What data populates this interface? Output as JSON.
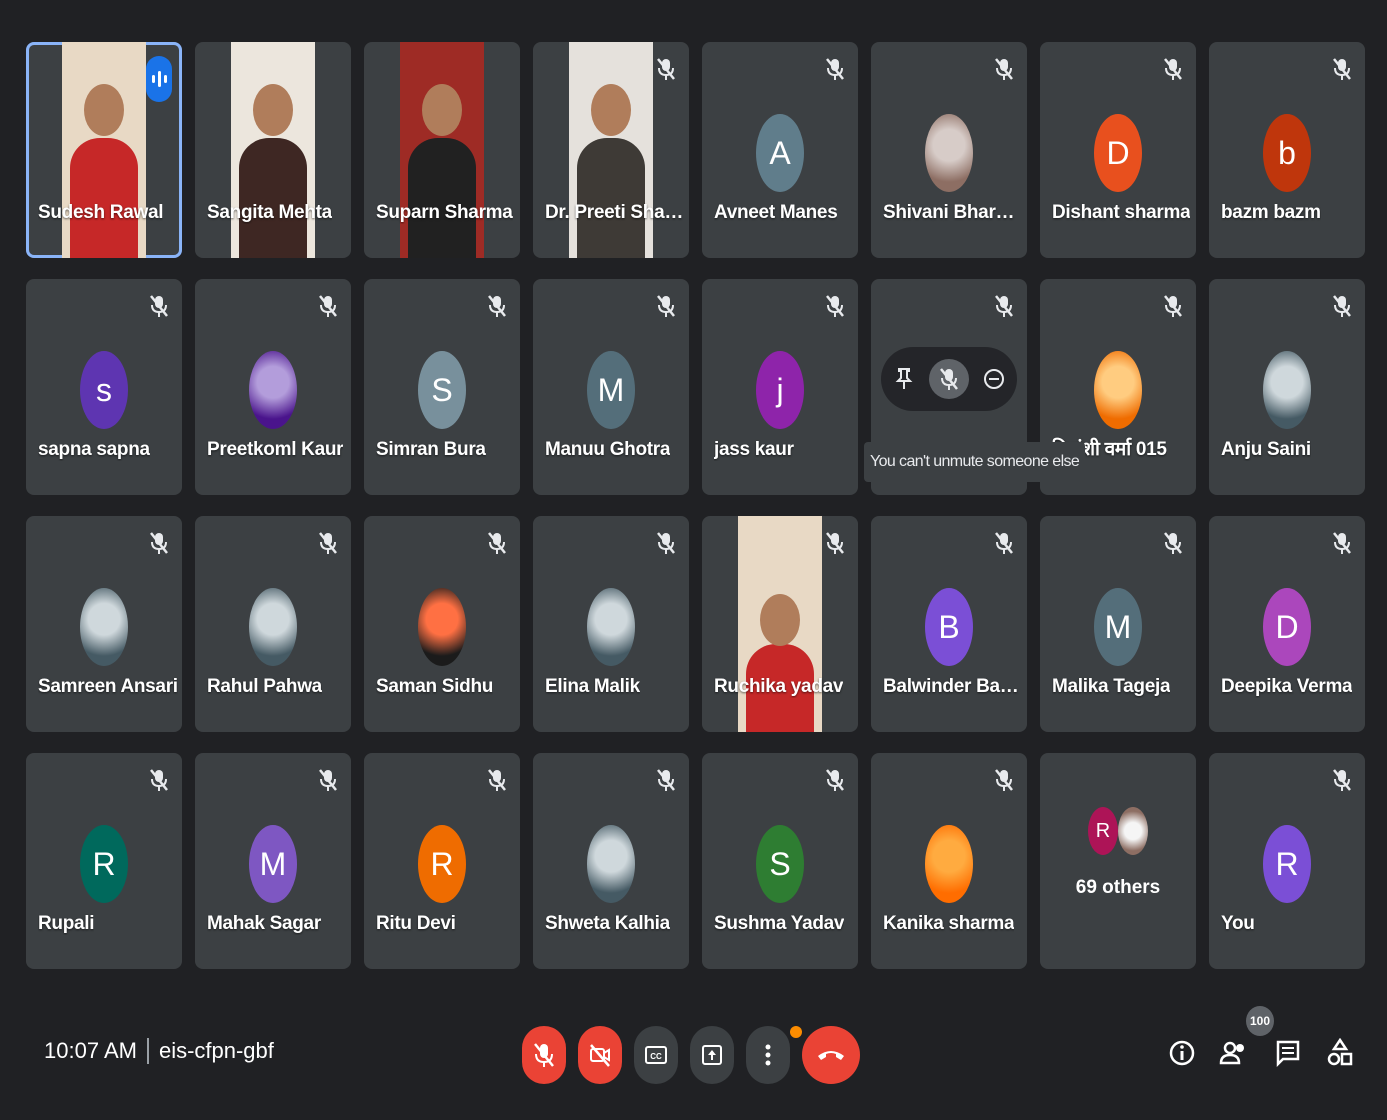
{
  "meeting": {
    "time": "10:07 AM",
    "code": "eis-cfpn-gbf",
    "participant_count": "100",
    "tooltip": "You can't unmute someone else"
  },
  "colors": {
    "background": "#202124",
    "tile": "#3c4043",
    "speaking_border": "#8ab4f8",
    "end_call": "#ea4335"
  },
  "participants": [
    {
      "name": "Sudesh Rawal",
      "kind": "video",
      "speaking": true
    },
    {
      "name": "Sangita Mehta",
      "kind": "video"
    },
    {
      "name": "Suparn Sharma",
      "kind": "video"
    },
    {
      "name": "Dr. Preeti Shar...",
      "kind": "video",
      "muted": true
    },
    {
      "name": "Avneet Manes",
      "initial": "A",
      "color": "#607d8b",
      "muted": true
    },
    {
      "name": "Shivani Bhargav",
      "kind": "photo",
      "icon": "cartoon-mouse",
      "muted": true
    },
    {
      "name": "Dishant sharma",
      "initial": "D",
      "color": "#e8501e",
      "muted": true
    },
    {
      "name": "bazm bazm",
      "initial": "b",
      "color": "#bf360c",
      "muted": true
    },
    {
      "name": "sapna sapna",
      "initial": "s",
      "color": "#5e35b1",
      "muted": true
    },
    {
      "name": "Preetkoml Kaur",
      "kind": "photo",
      "icon": "moon-art",
      "muted": true
    },
    {
      "name": "Simran Bura",
      "initial": "S",
      "color": "#78909c",
      "muted": true
    },
    {
      "name": "Manuu Ghotra",
      "initial": "M",
      "color": "#546e7a",
      "muted": true
    },
    {
      "name": "jass kaur",
      "initial": "j",
      "color": "#8e24aa",
      "muted": true
    },
    {
      "name": "",
      "kind": "hover",
      "muted": true
    },
    {
      "name": "दिपांशी वर्मा 015",
      "kind": "photo",
      "icon": "hand-photo",
      "muted": true
    },
    {
      "name": "Anju Saini",
      "kind": "photo",
      "icon": "person-photo",
      "muted": true
    },
    {
      "name": "Samreen Ansari",
      "kind": "photo",
      "icon": "person-photo",
      "muted": true
    },
    {
      "name": "Rahul Pahwa",
      "kind": "photo",
      "icon": "person-photo",
      "muted": true
    },
    {
      "name": "Saman Sidhu",
      "kind": "photo",
      "icon": "fire-logo",
      "muted": true
    },
    {
      "name": "Elina Malik",
      "kind": "photo",
      "icon": "person-photo",
      "muted": true
    },
    {
      "name": "Ruchika yadav",
      "kind": "video",
      "muted": true
    },
    {
      "name": "Balwinder Barna",
      "initial": "B",
      "color": "#7b4fd6",
      "muted": true
    },
    {
      "name": "Malika Tageja",
      "initial": "M",
      "color": "#546e7a",
      "muted": true
    },
    {
      "name": "Deepika Verma",
      "initial": "D",
      "color": "#ab47bc",
      "muted": true
    },
    {
      "name": "Rupali",
      "initial": "R",
      "color": "#00695c",
      "muted": true
    },
    {
      "name": "Mahak Sagar",
      "initial": "M",
      "color": "#7e57c2",
      "muted": true
    },
    {
      "name": "Ritu Devi",
      "initial": "R",
      "color": "#ef6c00",
      "muted": true
    },
    {
      "name": "Shweta Kalhia",
      "kind": "photo",
      "icon": "person-photo",
      "muted": true
    },
    {
      "name": "Sushma Yadav",
      "initial": "S",
      "color": "#2e7d32",
      "muted": true
    },
    {
      "name": "Kanika sharma",
      "kind": "photo",
      "icon": "orange-logo",
      "muted": true
    },
    {
      "name": "",
      "kind": "others",
      "others_label": "69 others",
      "initial": "R"
    },
    {
      "name": "You",
      "initial": "R",
      "color": "#7b4fd6",
      "muted": true
    }
  ],
  "controls": {
    "mic": "mic-off-icon",
    "camera": "camera-off-icon",
    "captions": "captions-icon",
    "present": "present-icon",
    "more": "more-vert-icon",
    "leave": "call-end-icon",
    "info": "info-icon",
    "people": "people-icon",
    "chat": "chat-icon",
    "activities": "activities-icon"
  }
}
